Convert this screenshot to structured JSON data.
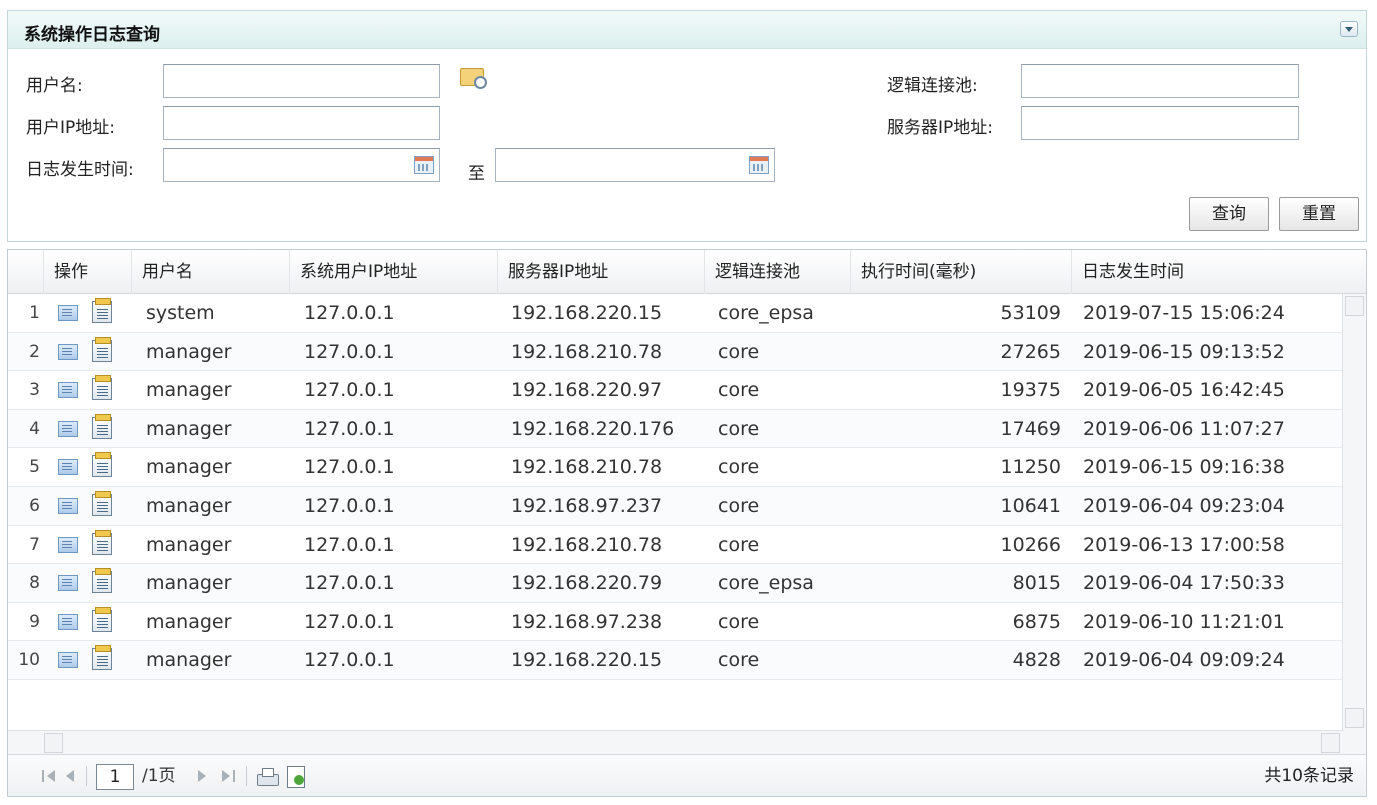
{
  "panel": {
    "title": "系统操作日志查询",
    "labels": {
      "username": "用户名:",
      "user_ip": "用户IP地址:",
      "log_time": "日志发生时间:",
      "to": "至",
      "logic_pool": "逻辑连接池:",
      "server_ip": "服务器IP地址:"
    },
    "values": {
      "username": "",
      "user_ip": "",
      "time_from": "",
      "time_to": "",
      "logic_pool": "",
      "server_ip": ""
    },
    "buttons": {
      "query": "查询",
      "reset": "重置"
    }
  },
  "grid": {
    "headers": {
      "ops": "操作",
      "username": "用户名",
      "system_ip": "系统用户IP地址",
      "server_ip": "服务器IP地址",
      "pool": "逻辑连接池",
      "exec_ms": "执行时间(毫秒)",
      "log_time": "日志发生时间"
    },
    "rows": [
      {
        "num": "1",
        "user": "system",
        "sip": "127.0.0.1",
        "srv": "192.168.220.15",
        "pool": "core_epsa",
        "exec": "53109",
        "time": "2019-07-15 15:06:24"
      },
      {
        "num": "2",
        "user": "manager",
        "sip": "127.0.0.1",
        "srv": "192.168.210.78",
        "pool": "core",
        "exec": "27265",
        "time": "2019-06-15 09:13:52"
      },
      {
        "num": "3",
        "user": "manager",
        "sip": "127.0.0.1",
        "srv": "192.168.220.97",
        "pool": "core",
        "exec": "19375",
        "time": "2019-06-05 16:42:45"
      },
      {
        "num": "4",
        "user": "manager",
        "sip": "127.0.0.1",
        "srv": "192.168.220.176",
        "pool": "core",
        "exec": "17469",
        "time": "2019-06-06 11:07:27"
      },
      {
        "num": "5",
        "user": "manager",
        "sip": "127.0.0.1",
        "srv": "192.168.210.78",
        "pool": "core",
        "exec": "11250",
        "time": "2019-06-15 09:16:38"
      },
      {
        "num": "6",
        "user": "manager",
        "sip": "127.0.0.1",
        "srv": "192.168.97.237",
        "pool": "core",
        "exec": "10641",
        "time": "2019-06-04 09:23:04"
      },
      {
        "num": "7",
        "user": "manager",
        "sip": "127.0.0.1",
        "srv": "192.168.210.78",
        "pool": "core",
        "exec": "10266",
        "time": "2019-06-13 17:00:58"
      },
      {
        "num": "8",
        "user": "manager",
        "sip": "127.0.0.1",
        "srv": "192.168.220.79",
        "pool": "core_epsa",
        "exec": "8015",
        "time": "2019-06-04 17:50:33"
      },
      {
        "num": "9",
        "user": "manager",
        "sip": "127.0.0.1",
        "srv": "192.168.97.238",
        "pool": "core",
        "exec": "6875",
        "time": "2019-06-10 11:21:01"
      },
      {
        "num": "10",
        "user": "manager",
        "sip": "127.0.0.1",
        "srv": "192.168.220.15",
        "pool": "core",
        "exec": "4828",
        "time": "2019-06-04 09:09:24"
      }
    ]
  },
  "pager": {
    "current_page": "1",
    "total_pages": "/1页",
    "record_count": "共10条记录"
  },
  "icons": [
    "collapse-icon",
    "user-picker-icon",
    "calendar-icon",
    "view-icon",
    "detail-icon",
    "first-page-icon",
    "prev-page-icon",
    "next-page-icon",
    "last-page-icon",
    "print-icon",
    "export-icon"
  ]
}
